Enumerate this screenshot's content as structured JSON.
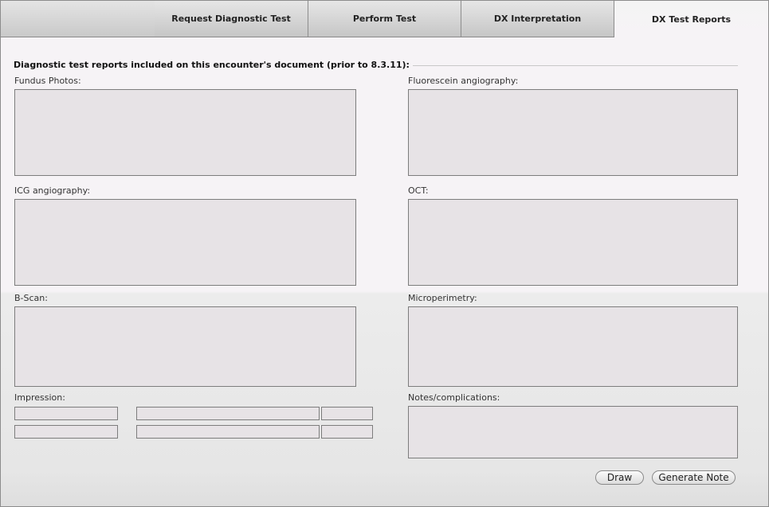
{
  "tabs": [
    {
      "label": "Request Diagnostic Test",
      "active": false
    },
    {
      "label": "Perform Test",
      "active": false
    },
    {
      "label": "DX Interpretation",
      "active": false
    },
    {
      "label": "DX Test Reports",
      "active": true
    }
  ],
  "section": {
    "title": "Diagnostic test reports included on this encounter's document (prior to 8.3.11):"
  },
  "fields": {
    "fundus_photos": {
      "label": "Fundus Photos:",
      "value": ""
    },
    "fluorescein_angiography": {
      "label": "Fluorescein angiography:",
      "value": ""
    },
    "icg_angiography": {
      "label": "ICG angiography:",
      "value": ""
    },
    "oct": {
      "label": "OCT:",
      "value": ""
    },
    "b_scan": {
      "label": "B-Scan:",
      "value": ""
    },
    "microperimetry": {
      "label": "Microperimetry:",
      "value": ""
    },
    "impression": {
      "label": "Impression:"
    },
    "notes": {
      "label": "Notes/complications:",
      "value": ""
    }
  },
  "buttons": {
    "draw": "Draw",
    "generate_note": "Generate Note"
  }
}
